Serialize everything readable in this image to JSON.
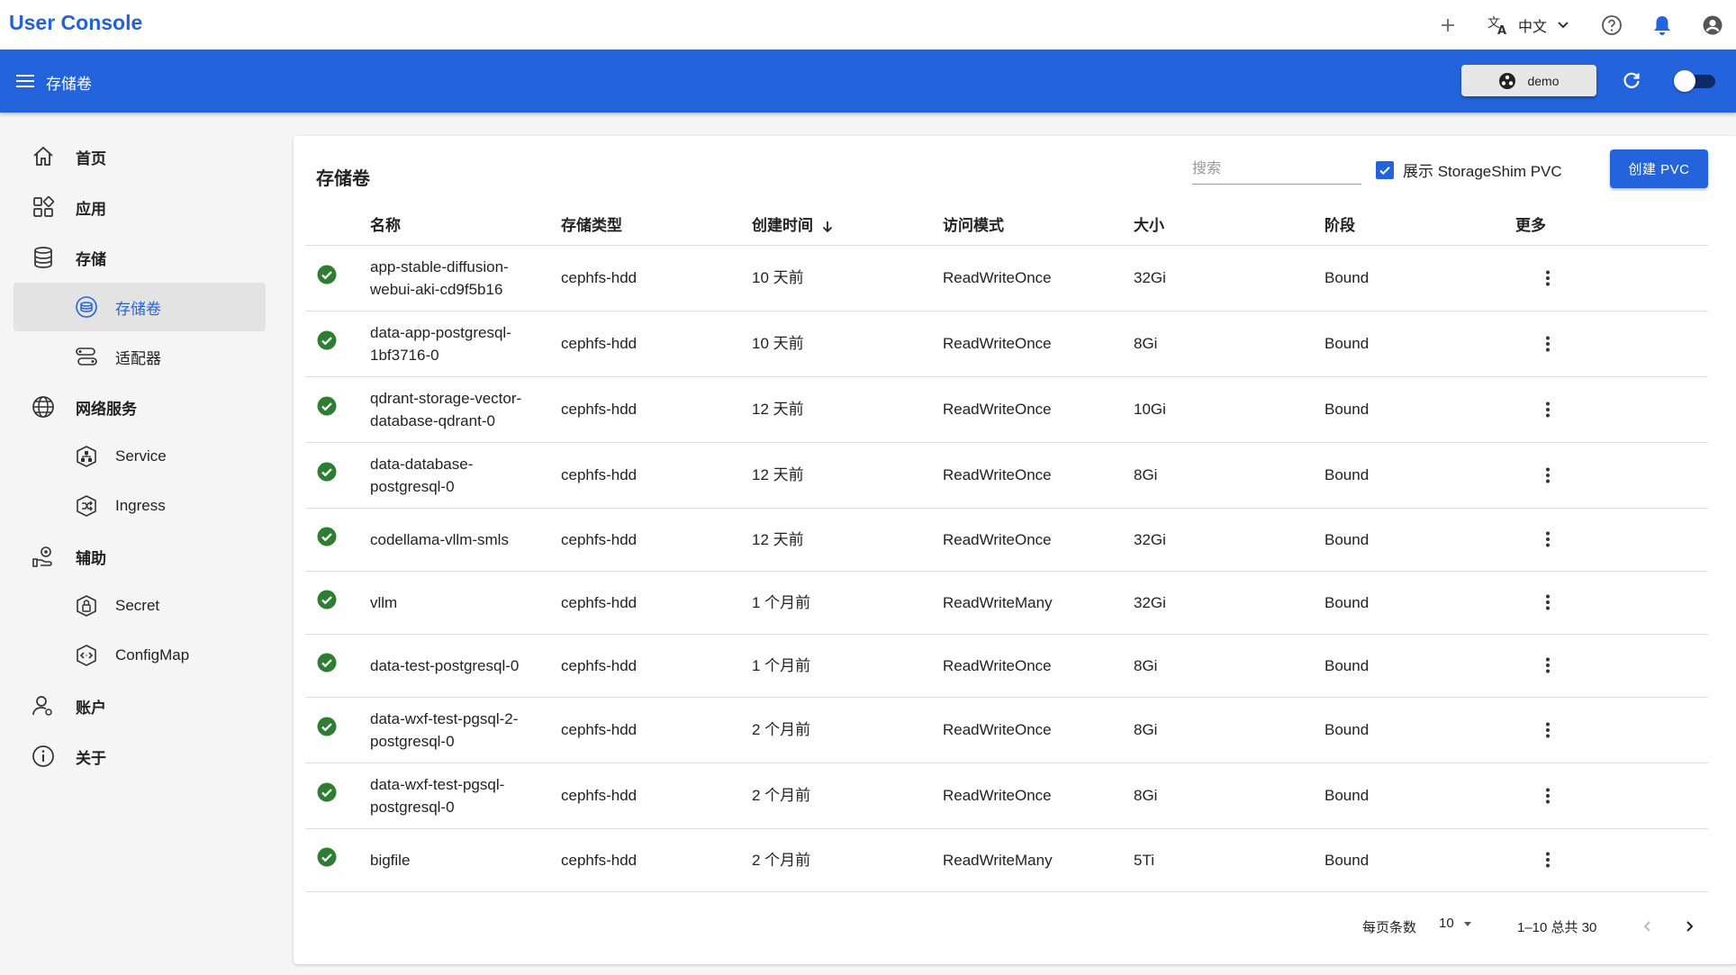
{
  "header": {
    "app_title": "User Console",
    "language_label": "中文"
  },
  "toolbar": {
    "page_title": "存储卷",
    "namespace": "demo"
  },
  "sidebar": {
    "items": [
      {
        "label": "首页",
        "icon": "home-icon",
        "level": "top"
      },
      {
        "label": "应用",
        "icon": "apps-icon",
        "level": "top"
      },
      {
        "label": "存储",
        "icon": "database-icon",
        "level": "top"
      },
      {
        "label": "存储卷",
        "icon": "volume-icon",
        "level": "sub",
        "active": true
      },
      {
        "label": "适配器",
        "icon": "adapter-icon",
        "level": "sub"
      },
      {
        "label": "网络服务",
        "icon": "globe-icon",
        "level": "top"
      },
      {
        "label": "Service",
        "icon": "service-icon",
        "level": "sub"
      },
      {
        "label": "Ingress",
        "icon": "ingress-icon",
        "level": "sub"
      },
      {
        "label": "辅助",
        "icon": "assist-icon",
        "level": "top"
      },
      {
        "label": "Secret",
        "icon": "secret-icon",
        "level": "sub"
      },
      {
        "label": "ConfigMap",
        "icon": "configmap-icon",
        "level": "sub"
      },
      {
        "label": "账户",
        "icon": "account-icon",
        "level": "top"
      },
      {
        "label": "关于",
        "icon": "info-icon",
        "level": "top"
      }
    ]
  },
  "main": {
    "title": "存储卷",
    "search_placeholder": "搜索",
    "show_storageshim_label": "展示 StorageShim PVC",
    "show_storageshim_checked": true,
    "create_button": "创建 PVC",
    "columns": [
      "名称",
      "存储类型",
      "创建时间",
      "访问模式",
      "大小",
      "阶段",
      "更多"
    ],
    "rows": [
      {
        "name": "app-stable-diffusion-webui-aki-cd9f5b16",
        "type": "cephfs-hdd",
        "created": "10 天前",
        "mode": "ReadWriteOnce",
        "size": "32Gi",
        "phase": "Bound"
      },
      {
        "name": "data-app-postgresql-1bf3716-0",
        "type": "cephfs-hdd",
        "created": "10 天前",
        "mode": "ReadWriteOnce",
        "size": "8Gi",
        "phase": "Bound"
      },
      {
        "name": "qdrant-storage-vector-database-qdrant-0",
        "type": "cephfs-hdd",
        "created": "12 天前",
        "mode": "ReadWriteOnce",
        "size": "10Gi",
        "phase": "Bound"
      },
      {
        "name": "data-database-postgresql-0",
        "type": "cephfs-hdd",
        "created": "12 天前",
        "mode": "ReadWriteOnce",
        "size": "8Gi",
        "phase": "Bound"
      },
      {
        "name": "codellama-vllm-smls",
        "type": "cephfs-hdd",
        "created": "12 天前",
        "mode": "ReadWriteOnce",
        "size": "32Gi",
        "phase": "Bound"
      },
      {
        "name": "vllm",
        "type": "cephfs-hdd",
        "created": "1 个月前",
        "mode": "ReadWriteMany",
        "size": "32Gi",
        "phase": "Bound"
      },
      {
        "name": "data-test-postgresql-0",
        "type": "cephfs-hdd",
        "created": "1 个月前",
        "mode": "ReadWriteOnce",
        "size": "8Gi",
        "phase": "Bound"
      },
      {
        "name": "data-wxf-test-pgsql-2-postgresql-0",
        "type": "cephfs-hdd",
        "created": "2 个月前",
        "mode": "ReadWriteOnce",
        "size": "8Gi",
        "phase": "Bound"
      },
      {
        "name": "data-wxf-test-pgsql-postgresql-0",
        "type": "cephfs-hdd",
        "created": "2 个月前",
        "mode": "ReadWriteOnce",
        "size": "8Gi",
        "phase": "Bound"
      },
      {
        "name": "bigfile",
        "type": "cephfs-hdd",
        "created": "2 个月前",
        "mode": "ReadWriteMany",
        "size": "5Ti",
        "phase": "Bound"
      }
    ]
  },
  "pagination": {
    "rows_per_page_label": "每页条数",
    "rows_per_page": "10",
    "range": "1–10 总共 30"
  },
  "colors": {
    "primary": "#2364dd",
    "status_ok": "#2e7d32"
  }
}
